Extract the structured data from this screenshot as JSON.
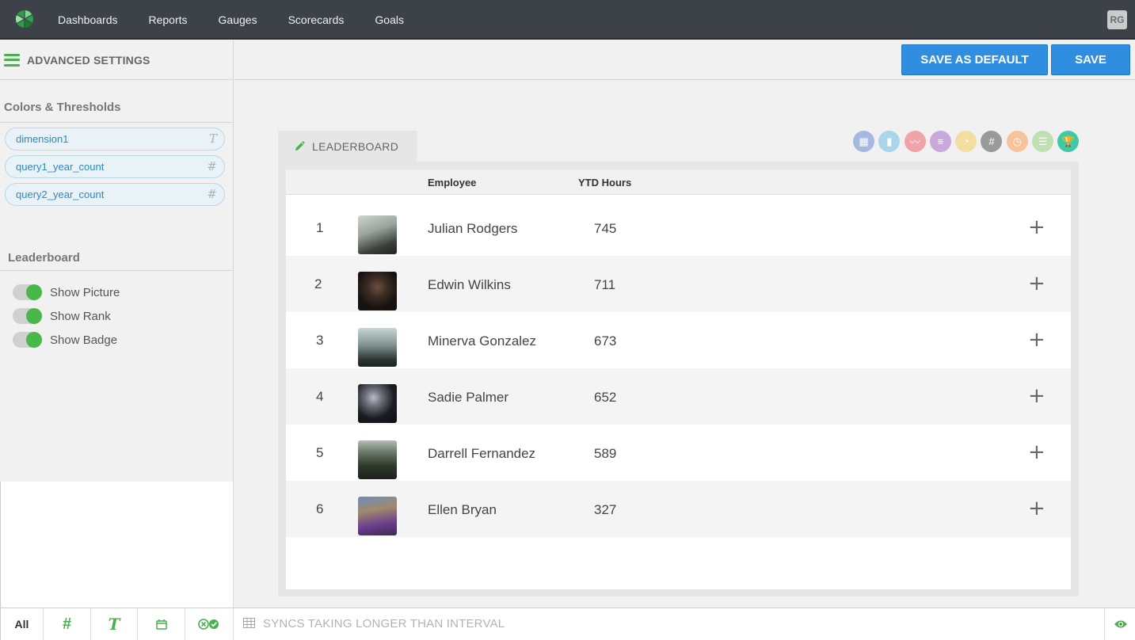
{
  "nav": {
    "items": [
      "Dashboards",
      "Reports",
      "Gauges",
      "Scorecards",
      "Goals"
    ],
    "user_initials": "RG"
  },
  "sidebar": {
    "title": "ADVANCED SETTINGS",
    "colors_section": "Colors & Thresholds",
    "fields": [
      {
        "label": "dimension1",
        "type": "T",
        "icon": "text-type-icon"
      },
      {
        "label": "query1_year_count",
        "type": "#",
        "icon": "number-type-icon"
      },
      {
        "label": "query2_year_count",
        "type": "#",
        "icon": "number-type-icon"
      }
    ],
    "leaderboard_section": "Leaderboard",
    "toggles": [
      {
        "label": "Show Picture",
        "on": true
      },
      {
        "label": "Show Rank",
        "on": true
      },
      {
        "label": "Show Badge",
        "on": true
      }
    ]
  },
  "actions": {
    "save_default": "SAVE AS DEFAULT",
    "save": "SAVE"
  },
  "widget": {
    "tab_label": "LEADERBOARD",
    "type_icons": [
      {
        "name": "table-icon",
        "color": "#a6b8e0",
        "glyph": "▦"
      },
      {
        "name": "bar-chart-icon",
        "color": "#a9d6ea",
        "glyph": "▮"
      },
      {
        "name": "line-chart-icon",
        "color": "#f0a3a8",
        "glyph": "〰"
      },
      {
        "name": "horizontal-bar-icon",
        "color": "#c9a8dc",
        "glyph": "≡"
      },
      {
        "name": "speedometer-icon",
        "color": "#f2dea0",
        "glyph": "◔"
      },
      {
        "name": "number-icon",
        "color": "#9a9a9a",
        "glyph": "#"
      },
      {
        "name": "gauge-icon",
        "color": "#f6c49a",
        "glyph": "◷"
      },
      {
        "name": "list-icon",
        "color": "#bfe0b0",
        "glyph": "☰"
      },
      {
        "name": "trophy-icon",
        "color": "#3fc9a6",
        "glyph": "🏆"
      }
    ],
    "columns": {
      "employee": "Employee",
      "hours": "YTD Hours"
    },
    "rows": [
      {
        "rank": "1",
        "name": "Julian Rodgers",
        "hours": "745"
      },
      {
        "rank": "2",
        "name": "Edwin Wilkins",
        "hours": "711"
      },
      {
        "rank": "3",
        "name": "Minerva Gonzalez",
        "hours": "673"
      },
      {
        "rank": "4",
        "name": "Sadie Palmer",
        "hours": "652"
      },
      {
        "rank": "5",
        "name": "Darrell Fernandez",
        "hours": "589"
      },
      {
        "rank": "6",
        "name": "Ellen Bryan",
        "hours": "327"
      }
    ]
  },
  "bottombar": {
    "all_label": "All",
    "sync_message": "SYNCS TAKING LONGER THAN INTERVAL"
  }
}
